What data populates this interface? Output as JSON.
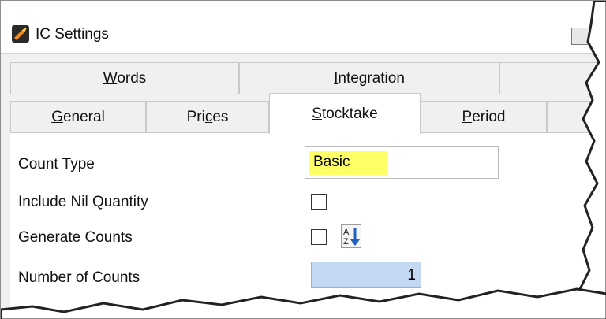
{
  "window": {
    "title": "IC Settings"
  },
  "tabs": {
    "top_row": [
      {
        "label": "Words",
        "mnemonic_index": 0
      },
      {
        "label": "Integration",
        "mnemonic_index": 0
      }
    ],
    "bottom_row": [
      {
        "label": "General",
        "mnemonic_index": 0
      },
      {
        "label": "Prices",
        "mnemonic_index": 3
      },
      {
        "label": "Stocktake",
        "mnemonic_index": 0,
        "active": true
      },
      {
        "label": "Period",
        "mnemonic_index": 0
      }
    ]
  },
  "form": {
    "count_type": {
      "label": "Count Type",
      "value": "Basic"
    },
    "include_nil_quantity": {
      "label": "Include Nil Quantity",
      "checked": false
    },
    "generate_counts": {
      "label": "Generate Counts",
      "checked": false
    },
    "number_of_counts": {
      "label": "Number of Counts",
      "value": "1"
    }
  },
  "icons": {
    "app": "ic-settings-app-icon",
    "sort": "sort-az-icon"
  },
  "colors": {
    "highlight": "#ffff66",
    "number_field": "#c3d9f3",
    "sort_arrow": "#1e5fbf"
  }
}
